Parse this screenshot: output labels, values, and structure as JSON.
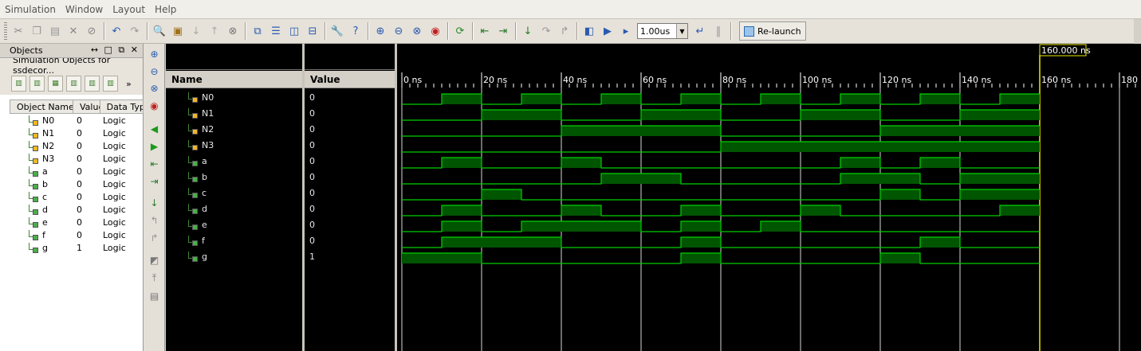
{
  "menu": [
    "Simulation",
    "Window",
    "Layout",
    "Help"
  ],
  "toolbar": {
    "time_step_value": "1.00us",
    "relaunch_label": "Re-launch"
  },
  "objects_panel": {
    "title": "Objects",
    "window_controls": "↔ □ ⧉ ✕",
    "subtitle": "Simulation Objects for ssdecor...",
    "more_label": "»",
    "columns": [
      "Object Name",
      "Value",
      "Data Type"
    ],
    "rows": [
      {
        "name": "N0",
        "value": "0",
        "type": "Logic",
        "icon": "input-bit-icon"
      },
      {
        "name": "N1",
        "value": "0",
        "type": "Logic",
        "icon": "input-bit-icon"
      },
      {
        "name": "N2",
        "value": "0",
        "type": "Logic",
        "icon": "input-bit-icon"
      },
      {
        "name": "N3",
        "value": "0",
        "type": "Logic",
        "icon": "input-bit-icon"
      },
      {
        "name": "a",
        "value": "0",
        "type": "Logic",
        "icon": "output-bit-icon"
      },
      {
        "name": "b",
        "value": "0",
        "type": "Logic",
        "icon": "output-bit-icon"
      },
      {
        "name": "c",
        "value": "0",
        "type": "Logic",
        "icon": "output-bit-icon"
      },
      {
        "name": "d",
        "value": "0",
        "type": "Logic",
        "icon": "output-bit-icon"
      },
      {
        "name": "e",
        "value": "0",
        "type": "Logic",
        "icon": "output-bit-icon"
      },
      {
        "name": "f",
        "value": "0",
        "type": "Logic",
        "icon": "output-bit-icon"
      },
      {
        "name": "g",
        "value": "1",
        "type": "Logic",
        "icon": "output-bit-icon"
      }
    ]
  },
  "waveform": {
    "name_header": "Name",
    "value_header": "Value",
    "cursor_label": "160.000 ns",
    "cursor_time_ns": 160,
    "time_ticks": [
      "0 ns",
      "20 ns",
      "40 ns",
      "60 ns",
      "80 ns",
      "100 ns",
      "120 ns",
      "140 ns",
      "160 ns",
      "180 ns"
    ],
    "tick_step_ns": 20,
    "segment_ns": 10,
    "sim_end_ns": 160,
    "colors": {
      "wave": "#00d000",
      "fill": "#005500",
      "cursor": "#e8e800",
      "grid": "#ffffff",
      "background": "#000000"
    },
    "signals": [
      {
        "name": "N0",
        "value": "0",
        "icon": "input-bit-icon",
        "bits": [
          0,
          1,
          0,
          1,
          0,
          1,
          0,
          1,
          0,
          1,
          0,
          1,
          0,
          1,
          0,
          1
        ]
      },
      {
        "name": "N1",
        "value": "0",
        "icon": "input-bit-icon",
        "bits": [
          0,
          0,
          1,
          1,
          0,
          0,
          1,
          1,
          0,
          0,
          1,
          1,
          0,
          0,
          1,
          1
        ]
      },
      {
        "name": "N2",
        "value": "0",
        "icon": "input-bit-icon",
        "bits": [
          0,
          0,
          0,
          0,
          1,
          1,
          1,
          1,
          0,
          0,
          0,
          0,
          1,
          1,
          1,
          1
        ]
      },
      {
        "name": "N3",
        "value": "0",
        "icon": "input-bit-icon",
        "bits": [
          0,
          0,
          0,
          0,
          0,
          0,
          0,
          0,
          1,
          1,
          1,
          1,
          1,
          1,
          1,
          1
        ]
      },
      {
        "name": "a",
        "value": "0",
        "icon": "output-bit-icon",
        "bits": [
          0,
          1,
          0,
          0,
          1,
          0,
          0,
          0,
          0,
          0,
          0,
          1,
          0,
          1,
          0,
          0
        ]
      },
      {
        "name": "b",
        "value": "0",
        "icon": "output-bit-icon",
        "bits": [
          0,
          0,
          0,
          0,
          0,
          1,
          1,
          0,
          0,
          0,
          0,
          1,
          1,
          0,
          1,
          1
        ]
      },
      {
        "name": "c",
        "value": "0",
        "icon": "output-bit-icon",
        "bits": [
          0,
          0,
          1,
          0,
          0,
          0,
          0,
          0,
          0,
          0,
          0,
          0,
          1,
          0,
          1,
          1
        ]
      },
      {
        "name": "d",
        "value": "0",
        "icon": "output-bit-icon",
        "bits": [
          0,
          1,
          0,
          0,
          1,
          0,
          0,
          1,
          0,
          0,
          1,
          0,
          0,
          0,
          0,
          1
        ]
      },
      {
        "name": "e",
        "value": "0",
        "icon": "output-bit-icon",
        "bits": [
          0,
          1,
          0,
          1,
          1,
          1,
          0,
          1,
          0,
          1,
          0,
          0,
          0,
          0,
          0,
          0
        ]
      },
      {
        "name": "f",
        "value": "0",
        "icon": "output-bit-icon",
        "bits": [
          0,
          1,
          1,
          1,
          0,
          0,
          0,
          1,
          0,
          0,
          0,
          0,
          0,
          1,
          0,
          0
        ]
      },
      {
        "name": "g",
        "value": "1",
        "icon": "output-bit-icon",
        "bits": [
          1,
          1,
          0,
          0,
          0,
          0,
          0,
          1,
          0,
          0,
          0,
          0,
          1,
          0,
          0,
          0
        ]
      }
    ]
  }
}
